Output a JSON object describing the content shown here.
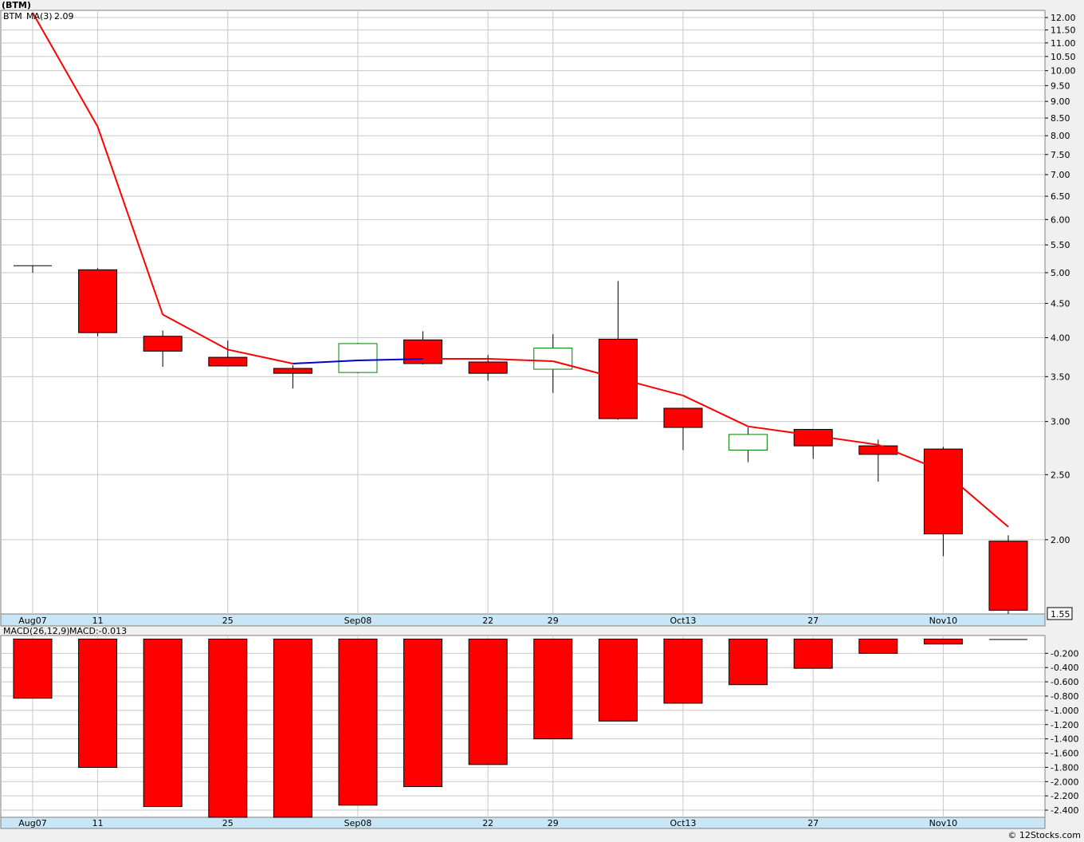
{
  "title": "(BTM)",
  "legend": {
    "symbol": "BTM",
    "ma_label": "MA(3)",
    "ma_value": "2.09",
    "macd_label": "MACD(26,12,9)",
    "macd_value_label": "MACD:-0.013"
  },
  "last_price_label": "1.55",
  "copyright": "© 12Stocks.com",
  "colors": {
    "down": "#ff0000",
    "up": "#008000",
    "ma_down": "#ff0000",
    "ma_up": "#0000cc",
    "grid": "#c8c8c8",
    "axis_band": "#c8e6f5",
    "page": "#f0f0f0",
    "plot": "#ffffff"
  },
  "chart_data": [
    {
      "type": "candlestick",
      "name": "price",
      "scale": "log",
      "ylim": [
        1.55,
        12.3
      ],
      "y_ticks": [
        "12.00",
        "11.50",
        "11.00",
        "10.50",
        "10.00",
        "9.50",
        "9.00",
        "8.50",
        "8.00",
        "7.50",
        "7.00",
        "6.50",
        "6.00",
        "5.50",
        "5.00",
        "4.50",
        "4.00",
        "3.50",
        "3.00",
        "2.50",
        "2.00"
      ],
      "x_tick_labels": [
        {
          "index": 0,
          "label": "Aug07"
        },
        {
          "index": 1,
          "label": "11"
        },
        {
          "index": 3,
          "label": "25"
        },
        {
          "index": 5,
          "label": "Sep08"
        },
        {
          "index": 7,
          "label": "22"
        },
        {
          "index": 8,
          "label": "29"
        },
        {
          "index": 10,
          "label": "Oct13"
        },
        {
          "index": 12,
          "label": "27"
        },
        {
          "index": 14,
          "label": "Nov10"
        }
      ],
      "candles": [
        {
          "open": 5.12,
          "high": 5.12,
          "low": 5.0,
          "close": 5.12
        },
        {
          "open": 5.05,
          "high": 5.08,
          "low": 4.02,
          "close": 4.07
        },
        {
          "open": 4.02,
          "high": 4.1,
          "low": 3.62,
          "close": 3.82
        },
        {
          "open": 3.74,
          "high": 3.96,
          "low": 3.63,
          "close": 3.63
        },
        {
          "open": 3.6,
          "high": 3.64,
          "low": 3.36,
          "close": 3.54
        },
        {
          "open": 3.55,
          "high": 3.93,
          "low": 3.54,
          "close": 3.92
        },
        {
          "open": 3.97,
          "high": 4.09,
          "low": 3.65,
          "close": 3.66
        },
        {
          "open": 3.68,
          "high": 3.77,
          "low": 3.45,
          "close": 3.54
        },
        {
          "open": 3.59,
          "high": 4.05,
          "low": 3.31,
          "close": 3.86
        },
        {
          "open": 3.98,
          "high": 4.86,
          "low": 3.02,
          "close": 3.03
        },
        {
          "open": 3.14,
          "high": 3.14,
          "low": 2.72,
          "close": 2.94
        },
        {
          "open": 2.72,
          "high": 2.94,
          "low": 2.61,
          "close": 2.87
        },
        {
          "open": 2.92,
          "high": 2.92,
          "low": 2.64,
          "close": 2.76
        },
        {
          "open": 2.76,
          "high": 2.82,
          "low": 2.44,
          "close": 2.68
        },
        {
          "open": 2.73,
          "high": 2.75,
          "low": 1.89,
          "close": 2.04
        },
        {
          "open": 1.99,
          "high": 2.03,
          "low": 1.55,
          "close": 1.57
        }
      ],
      "ma3": [
        12.2,
        8.25,
        4.33,
        3.84,
        3.66,
        3.7,
        3.72,
        3.72,
        3.69,
        3.48,
        3.28,
        2.95,
        2.86,
        2.77,
        2.53,
        2.09
      ]
    },
    {
      "type": "bar",
      "name": "MACD(26,12,9)",
      "ylim": [
        -2.5,
        0.05
      ],
      "y_ticks": [
        "-0.200",
        "-0.400",
        "-0.600",
        "-0.800",
        "-1.000",
        "-1.200",
        "-1.400",
        "-1.600",
        "-1.800",
        "-2.000",
        "-2.200",
        "-2.400"
      ],
      "values": [
        -0.83,
        -1.8,
        -2.35,
        -2.5,
        -2.5,
        -2.33,
        -2.07,
        -1.76,
        -1.4,
        -1.15,
        -0.9,
        -0.64,
        -0.41,
        -0.2,
        -0.07,
        -0.013
      ]
    }
  ]
}
